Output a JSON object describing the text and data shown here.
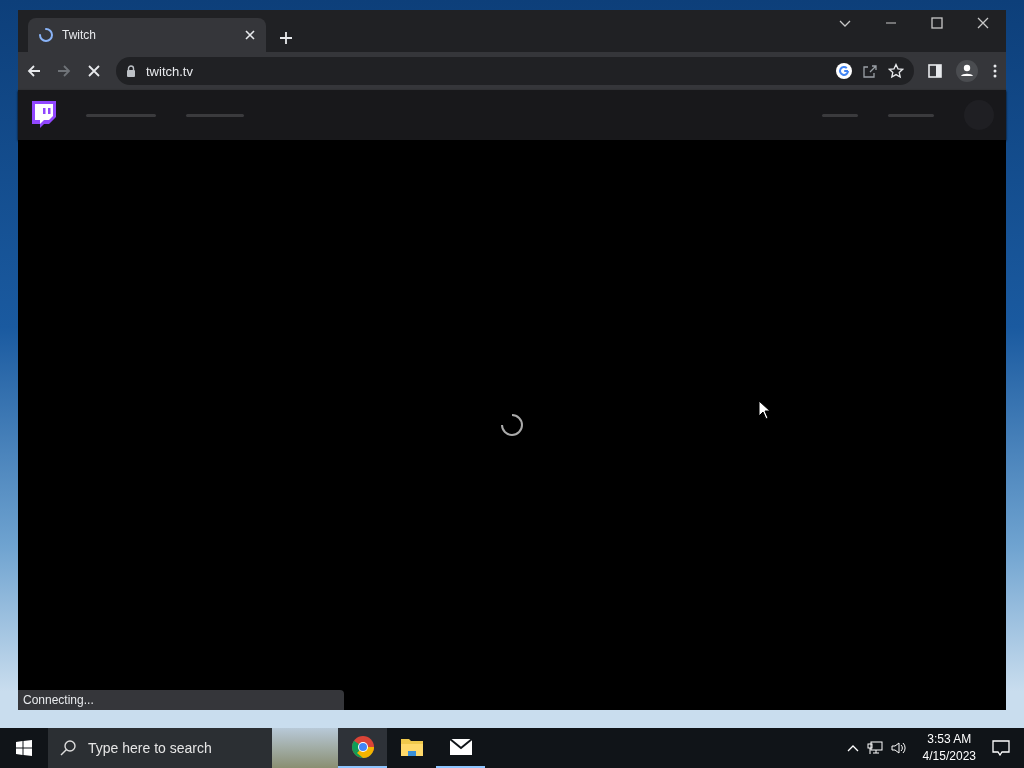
{
  "browser": {
    "tab": {
      "title": "Twitch",
      "loading": true
    },
    "address": "twitch.tv",
    "status": "Connecting..."
  },
  "taskbar": {
    "search": {
      "placeholder": "Type here to search"
    },
    "apps": [
      {
        "kind": "chrome",
        "selected": true,
        "running": true
      },
      {
        "kind": "explorer",
        "selected": false,
        "running": false
      },
      {
        "kind": "mail",
        "selected": false,
        "running": true
      }
    ],
    "clock": {
      "time": "3:53 AM",
      "date": "4/15/2023"
    }
  }
}
